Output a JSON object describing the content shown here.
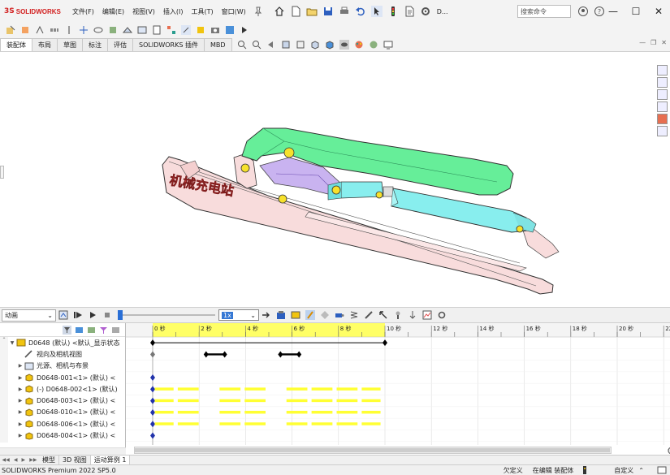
{
  "app": {
    "brand": "SOLIDWORKS",
    "brand_prefix": "3S",
    "menu": [
      "文件(F)",
      "编辑(E)",
      "视图(V)",
      "插入(I)",
      "工具(T)",
      "窗口(W)"
    ],
    "doc_short": "D...",
    "search_placeholder": "搜索命令",
    "window_controls": [
      "—",
      "☐",
      "✕"
    ]
  },
  "tabs": [
    "装配体",
    "布局",
    "草图",
    "标注",
    "评估",
    "SOLIDWORKS 插件",
    "MBD"
  ],
  "active_tab": "装配体",
  "viewport": {
    "model_label": "机械充电站"
  },
  "motion": {
    "study_type": "动画",
    "playback_speed": "1x",
    "time_labels": [
      "0 秒",
      "2 秒",
      "4 秒",
      "6 秒",
      "8 秒",
      "10 秒",
      "12 秒",
      "14 秒",
      "16 秒",
      "18 秒",
      "20 秒",
      "22"
    ],
    "duration_seconds": 10
  },
  "tree": {
    "rows": [
      {
        "label": "D0648 (默认) <默认_显示状态",
        "arrow": "▼"
      },
      {
        "label": "视向及相机视图",
        "arrow": ""
      },
      {
        "label": "光源、相机与布景",
        "arrow": "▶"
      },
      {
        "label": "D0648-001<1> (默认) <",
        "arrow": "▶"
      },
      {
        "label": "(-) D0648-002<1> (默认)",
        "arrow": "▶"
      },
      {
        "label": "D0648-003<1> (默认) <",
        "arrow": "▶"
      },
      {
        "label": "D0648-010<1> (默认) <",
        "arrow": "▶"
      },
      {
        "label": "D0648-006<1> (默认) <",
        "arrow": "▶"
      },
      {
        "label": "D0648-004<1> (默认) <",
        "arrow": "▶"
      }
    ]
  },
  "bottom_tabs": [
    "模型",
    "3D 视图",
    "运动算例 1"
  ],
  "active_bottom_tab": "运动算例 1",
  "status": {
    "version": "SOLIDWORKS Premium 2022 SP5.0",
    "cells": [
      "欠定义",
      "在编辑 装配体",
      "自定义"
    ]
  },
  "colors": {
    "timeline_header": "#ffff66",
    "timeline_bar": "#ffff33",
    "model_green": "#66ee99",
    "model_cyan": "#88eeee",
    "model_pink": "#f8dcdc",
    "model_violet": "#c9b3f0"
  }
}
